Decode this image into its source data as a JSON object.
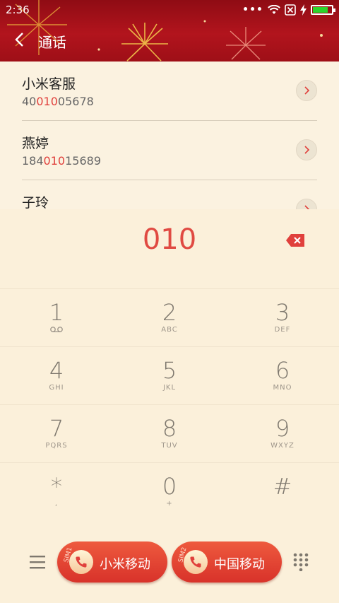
{
  "status_bar": {
    "time": "2:36",
    "more_dots": "•••"
  },
  "header": {
    "title": "通话"
  },
  "contacts": [
    {
      "name": "小米客服",
      "number_pre": "40",
      "number_match": "010",
      "number_post": "05678"
    },
    {
      "name": "燕婷",
      "number_pre": "184",
      "number_match": "010",
      "number_post": "15689"
    },
    {
      "name": "子玲",
      "number_pre": "",
      "number_match": "",
      "number_post": ""
    }
  ],
  "dial": {
    "number": "010"
  },
  "keypad": [
    {
      "digit": "1",
      "letters": ""
    },
    {
      "digit": "2",
      "letters": "ABC"
    },
    {
      "digit": "3",
      "letters": "DEF"
    },
    {
      "digit": "4",
      "letters": "GHI"
    },
    {
      "digit": "5",
      "letters": "JKL"
    },
    {
      "digit": "6",
      "letters": "MNO"
    },
    {
      "digit": "7",
      "letters": "PQRS"
    },
    {
      "digit": "8",
      "letters": "TUV"
    },
    {
      "digit": "9",
      "letters": "WXYZ"
    },
    {
      "digit": "*",
      "letters": ","
    },
    {
      "digit": "0",
      "letters": "+"
    },
    {
      "digit": "#",
      "letters": ""
    }
  ],
  "calls": [
    {
      "sim": "SIM1",
      "label": "小米移动"
    },
    {
      "sim": "SIM2",
      "label": "中国移动"
    }
  ],
  "colors": {
    "header_red": "#b2141d",
    "highlight": "#e0403c",
    "battery": "#2bd52b"
  }
}
